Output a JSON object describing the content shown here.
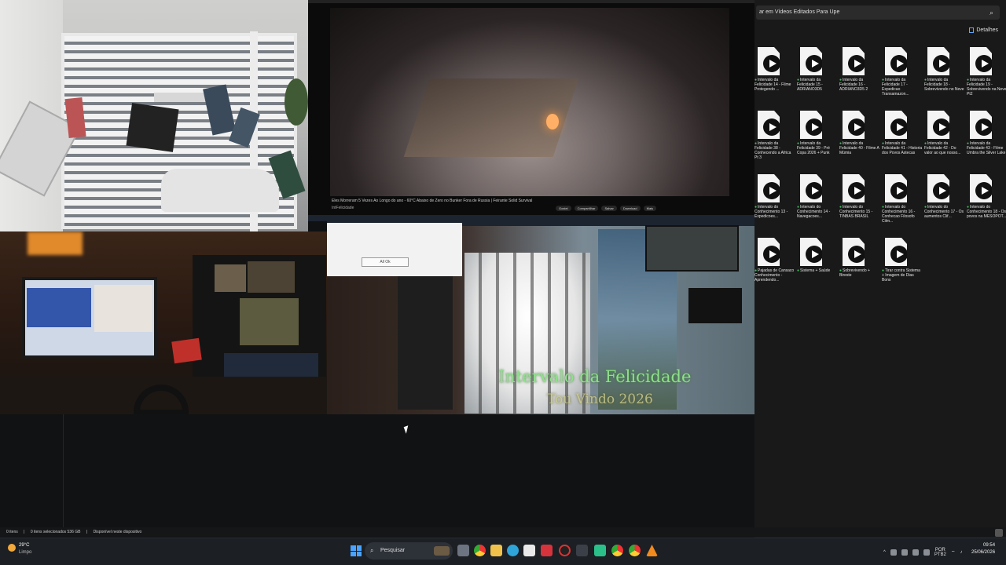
{
  "explorer": {
    "address": "ar em Vídeos Editados Para Upe",
    "details_label": "Detalhes",
    "files": [
      {
        "name": "Intervalo da Felicidade 14 - Filme Protegendo ..."
      },
      {
        "name": "Intervalo da Felicidade 15 - ADRIANO3D5"
      },
      {
        "name": "Intervalo da Felicidade 16 - ADRIANO3D5 2"
      },
      {
        "name": "Intervalo da Felicidade 17 - Expedicao Transamazon..."
      },
      {
        "name": "Intervalo da Felicidade 18 - Sobrevivendo no Neve"
      },
      {
        "name": "Intervalo da Felicidade 19 - Sobrevivendo na Neve Pt2"
      },
      {
        "name": "Intervalo da Felicidade 38 - Conhecendo a Africa Pt 3"
      },
      {
        "name": "Intervalo da Felicidade 39 - Pré Copa 2026 + Punk"
      },
      {
        "name": "Intervalo da Felicidade 40 - Filme A Múmia"
      },
      {
        "name": "Intervalo da Felicidade 41 - Historia dos Povos Astecas"
      },
      {
        "name": "Intervalo da Felicidade 42 - Do valor ao que nosso..."
      },
      {
        "name": "Intervalo da Felicidade 43 - Filme Umbra the Silver Lake"
      },
      {
        "name": "Intervalo do Conhecimento 13 - Expedicoes..."
      },
      {
        "name": "Intervalo do Conhecimento 14 - Navegacoes..."
      },
      {
        "name": "Intervalo do Conhecimento 15 - TINBAS BRASIL"
      },
      {
        "name": "Intervalo do Conhecimento 16 - Conhecao Filosofo Cilm..."
      },
      {
        "name": "Intervalo do Conhecimento 17 - Os aumentos Clif..."
      },
      {
        "name": "Intervalo do Conhecimento 18 - Os povos na MESOPOT..."
      },
      {
        "name": "Pajadas de Cansaco Conhecimento - Aprendendo..."
      },
      {
        "name": "Sistema + Saúde"
      },
      {
        "name": "Sobrevivendo + Bireste"
      },
      {
        "name": "Tirar contra Sistema + Imagem de Dias Bons"
      }
    ]
  },
  "player": {
    "video_title": "Eles Morreram 5 Vezes Ao Longo do ano - 60°C Abaixo de Zero no Bunker Fora de Russia | Feirante Solid Survival",
    "channel": "IntFelicidade",
    "actions": [
      "Gostei",
      "Compartilhar",
      "Salvar",
      "Download",
      "Mais"
    ]
  },
  "dialog": {
    "button_label": "All Ok"
  },
  "watermark": {
    "line1": "Intervalo da Felicidade",
    "line2": "Tou Vindo 2026"
  },
  "statusbar": {
    "items": "0 itens",
    "selected": "0 itens selecionados 536 GB",
    "availability": "Disponível neste dispositivo"
  },
  "taskbar": {
    "weather_temp": "29°C",
    "weather_desc": "Limpo",
    "search_placeholder": "Pesquisar",
    "language": "POR",
    "language_sub": "PTB2",
    "time": "09:54",
    "date": "25/06/2026"
  },
  "colors": {
    "watermark_green": "#8fe08a",
    "accent_blue": "#4aa3ff",
    "file_status_green": "#3fbf5f"
  }
}
